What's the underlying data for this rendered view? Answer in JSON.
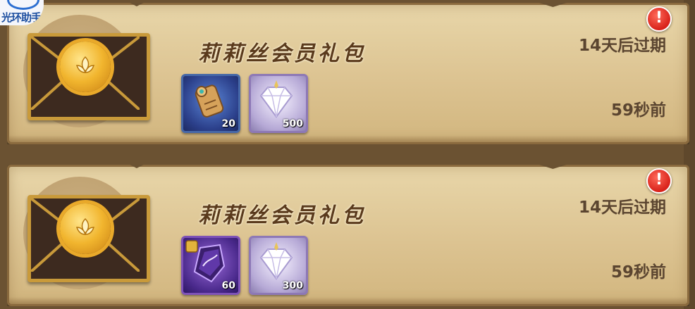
{
  "watermark": {
    "text": "光环助手"
  },
  "mails": [
    {
      "title": "莉莉丝会员礼包",
      "expire": "14天后过期",
      "time_ago": "59秒前",
      "items": [
        {
          "icon": "scroll-icon",
          "quantity": "20"
        },
        {
          "icon": "diamond-icon",
          "quantity": "500"
        }
      ]
    },
    {
      "title": "莉莉丝会员礼包",
      "expire": "14天后过期",
      "time_ago": "59秒前",
      "items": [
        {
          "icon": "crystal-shard-icon",
          "quantity": "60"
        },
        {
          "icon": "diamond-icon",
          "quantity": "300"
        }
      ]
    }
  ],
  "colors": {
    "paper": "#e8d6a9",
    "frame": "#8a6a3e",
    "alert": "#d8221a",
    "text": "#5b4530"
  }
}
